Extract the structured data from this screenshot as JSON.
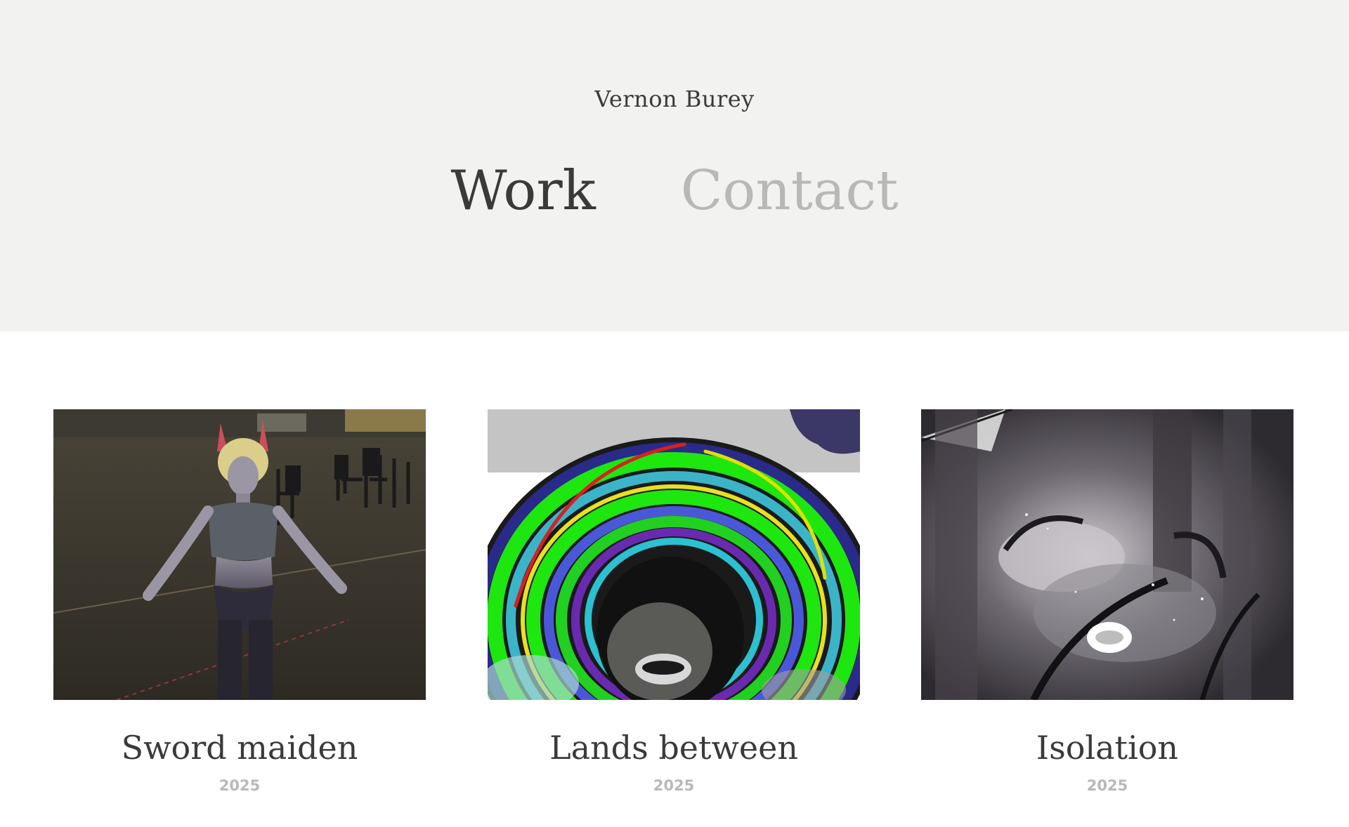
{
  "site": {
    "name": "Vernon Burey"
  },
  "nav": {
    "items": [
      {
        "label": "Work",
        "active": true
      },
      {
        "label": "Contact",
        "active": false
      }
    ]
  },
  "projects": [
    {
      "title": "Sword maiden",
      "year": "2025",
      "thumbnail": "3d-character-render"
    },
    {
      "title": "Lands between",
      "year": "2025",
      "thumbnail": "colorful-swirl-painting"
    },
    {
      "title": "Isolation",
      "year": "2025",
      "thumbnail": "monochrome-forest-painting"
    }
  ],
  "colors": {
    "header_bg": "#f2f2f0",
    "text_dark": "#3a3a3a",
    "text_muted": "#b8b8b8"
  }
}
